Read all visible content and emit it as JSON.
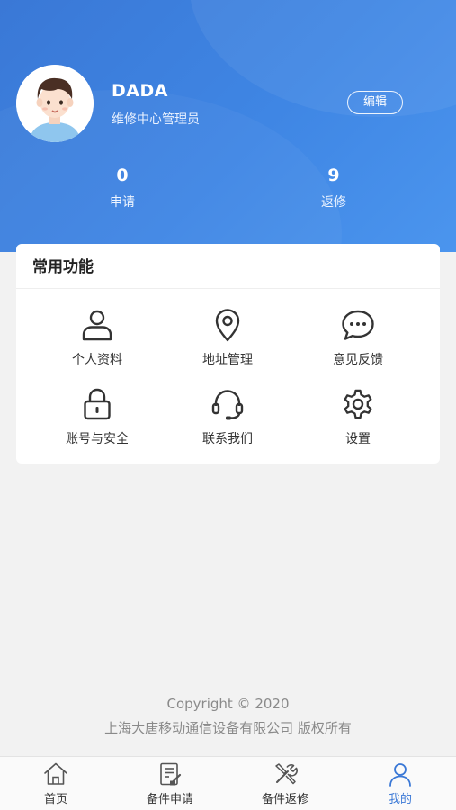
{
  "profile": {
    "name": "DADA",
    "role": "维修中心管理员",
    "edit_label": "编辑",
    "avatar_icon": "boy-avatar-icon"
  },
  "stats": {
    "apply": {
      "value": "0",
      "label": "申请"
    },
    "return": {
      "value": "9",
      "label": "返修"
    }
  },
  "functions": {
    "title": "常用功能",
    "items": [
      {
        "label": "个人资料",
        "icon": "user-icon"
      },
      {
        "label": "地址管理",
        "icon": "location-pin-icon"
      },
      {
        "label": "意见反馈",
        "icon": "chat-bubble-icon"
      },
      {
        "label": "账号与安全",
        "icon": "lock-icon"
      },
      {
        "label": "联系我们",
        "icon": "headset-icon"
      },
      {
        "label": "设置",
        "icon": "gear-icon"
      }
    ]
  },
  "footer": {
    "copyright": "Copyright © 2020",
    "company": "上海大唐移动通信设备有限公司 版权所有"
  },
  "tabbar": {
    "active_color": "#3a78d6",
    "items": [
      {
        "label": "首页",
        "icon": "home-icon"
      },
      {
        "label": "备件申请",
        "icon": "application-form-icon"
      },
      {
        "label": "备件返修",
        "icon": "tools-icon"
      },
      {
        "label": "我的",
        "icon": "profile-icon"
      }
    ]
  }
}
